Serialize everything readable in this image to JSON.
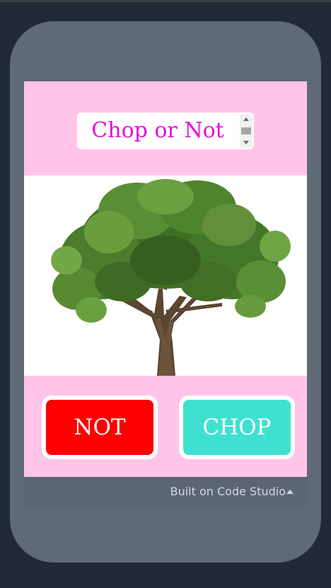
{
  "app": {
    "title": "Chop or Not",
    "image": {
      "description_icon": "tree-icon"
    },
    "buttons": {
      "not_label": "NOT",
      "chop_label": "CHOP"
    },
    "footer": {
      "text": "Built on Code Studio"
    },
    "colors": {
      "screen_bg": "#ffc4e8",
      "title_text": "#e40ed9",
      "not_button": "#fe0000",
      "chop_button": "#40e0d0"
    }
  }
}
